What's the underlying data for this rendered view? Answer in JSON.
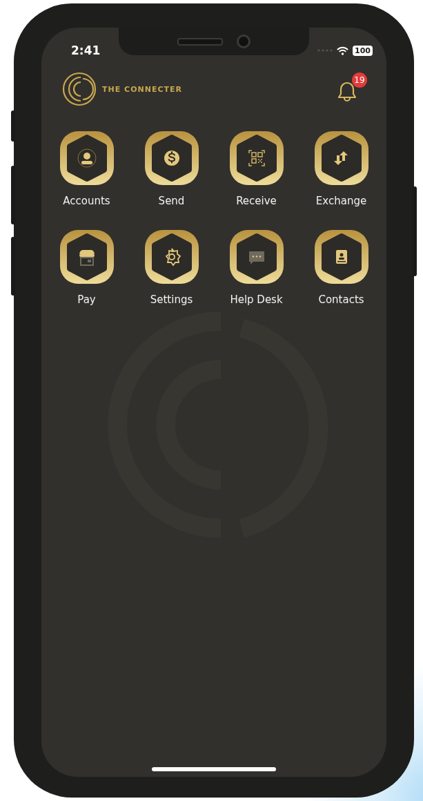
{
  "status_bar": {
    "time": "2:41",
    "battery": "100"
  },
  "header": {
    "brand": "THE CONNECTER",
    "notifications": "19"
  },
  "menu": [
    {
      "label": "Accounts",
      "kind": "person"
    },
    {
      "label": "Send",
      "kind": "dollar"
    },
    {
      "label": "Receive",
      "kind": "qr"
    },
    {
      "label": "Exchange",
      "kind": "arrows"
    },
    {
      "label": "Pay",
      "kind": "shop"
    },
    {
      "label": "Settings",
      "kind": "gear"
    },
    {
      "label": "Help Desk",
      "kind": "chat"
    },
    {
      "label": "Contacts",
      "kind": "contact"
    }
  ]
}
